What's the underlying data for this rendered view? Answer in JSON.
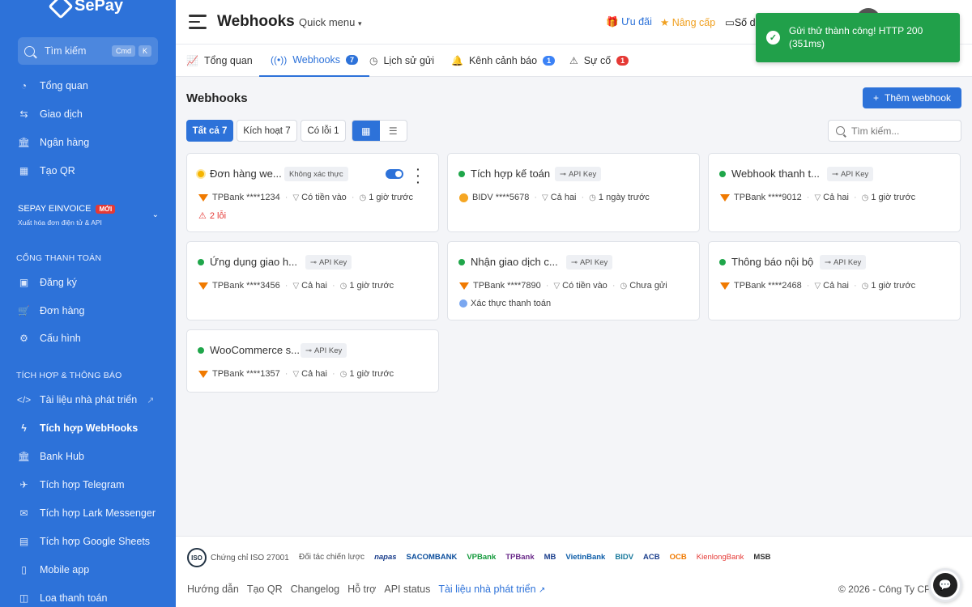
{
  "brand": {
    "name": "SePay"
  },
  "sidebar": {
    "search_label": "Tìm kiếm",
    "search_kbd": [
      "Cmd",
      "K"
    ],
    "main_items": [
      {
        "label": "Tổng quan",
        "icon": "dashboard-icon"
      },
      {
        "label": "Giao dịch",
        "icon": "transfer-icon"
      },
      {
        "label": "Ngân hàng",
        "icon": "bank-icon"
      },
      {
        "label": "Tạo QR",
        "icon": "qr-icon"
      }
    ],
    "einvoice": {
      "title": "SEPAY EINVOICE",
      "badge": "MỚI",
      "subtitle": "Xuất hóa đơn điện tử & API"
    },
    "section_payment": "CỔNG THANH TOÁN",
    "payment_items": [
      {
        "label": "Đăng ký"
      },
      {
        "label": "Đơn hàng"
      },
      {
        "label": "Cấu hình"
      }
    ],
    "section_integration": "TÍCH HỢP & THÔNG BÁO",
    "integration_items": [
      {
        "label": "Tài liệu nhà phát triển"
      },
      {
        "label": "Tích hợp WebHooks"
      },
      {
        "label": "Bank Hub"
      },
      {
        "label": "Tích hợp Telegram"
      },
      {
        "label": "Tích hợp Lark Messenger"
      },
      {
        "label": "Tích hợp Google Sheets"
      },
      {
        "label": "Mobile app"
      },
      {
        "label": "Loa thanh toán"
      }
    ]
  },
  "header": {
    "title": "Webhooks",
    "quick_menu": "Quick menu",
    "uu_dai": "Ưu đãi",
    "nang_cap": "Nâng cấp",
    "so_du": "Số d"
  },
  "toast": {
    "message": "Gửi thử thành công! HTTP 200 (351ms)"
  },
  "tabs": [
    {
      "label": "Tổng quan",
      "count": ""
    },
    {
      "label": "Webhooks",
      "count": "7"
    },
    {
      "label": "Lịch sử gửi",
      "count": ""
    },
    {
      "label": "Kênh cảnh báo",
      "count": "1"
    },
    {
      "label": "Sự cố",
      "count": "1"
    }
  ],
  "content": {
    "title": "Webhooks",
    "add_button": "Thêm webhook",
    "filters": [
      "Tất cả 7",
      "Kích hoạt 7",
      "Có lỗi 1"
    ],
    "search_placeholder": "Tìm kiếm..."
  },
  "webhooks": [
    {
      "name": "Đơn hàng we...",
      "badge": "Không xác thực",
      "bank": "TPBank ****1234",
      "filter": "Có tiền vào",
      "time": "1 giờ trước",
      "extra": "2 lỗi"
    },
    {
      "name": "Tích hợp kế toán",
      "badge": "API Key",
      "bank": "BIDV ****5678",
      "filter": "Cả hai",
      "time": "1 ngày trước"
    },
    {
      "name": "Webhook thanh t...",
      "badge": "API Key",
      "bank": "TPBank ****9012",
      "filter": "Cả hai",
      "time": "1 giờ trước"
    },
    {
      "name": "Ứng dụng giao h...",
      "badge": "API Key",
      "bank": "TPBank ****3456",
      "filter": "Cả hai",
      "time": "1 giờ trước"
    },
    {
      "name": "Nhận giao dịch c...",
      "badge": "API Key",
      "bank": "TPBank ****7890",
      "filter": "Có tiền vào",
      "time": "Chưa gửi",
      "extra": "Xác thực thanh toán"
    },
    {
      "name": "Thông báo nội bộ",
      "badge": "API Key",
      "bank": "TPBank ****2468",
      "filter": "Cả hai",
      "time": "1 giờ trước"
    },
    {
      "name": "WooCommerce s...",
      "badge": "API Key",
      "bank": "TPBank ****1357",
      "filter": "Cả hai",
      "time": "1 giờ trước"
    }
  ],
  "footer": {
    "iso": "Chứng chỉ ISO 27001",
    "partners_label": "Đối tác chiến lược",
    "partners": [
      "napas",
      "SACOMBANK",
      "VPBank",
      "TPBank",
      "MB",
      "VietinBank",
      "BIDV",
      "ACB",
      "OCB",
      "KienlongBank",
      "MSB"
    ],
    "links": [
      "Hướng dẫn",
      "Tạo QR",
      "Changelog",
      "Hỗ trợ",
      "API status"
    ],
    "dev_link": "Tài liệu nhà phát triển",
    "copyright": "© 2026 - Công Ty CP"
  },
  "colors": {
    "primary": "#2d72d9",
    "success": "#21a04a",
    "danger": "#e53935",
    "warning": "#f0a020"
  }
}
